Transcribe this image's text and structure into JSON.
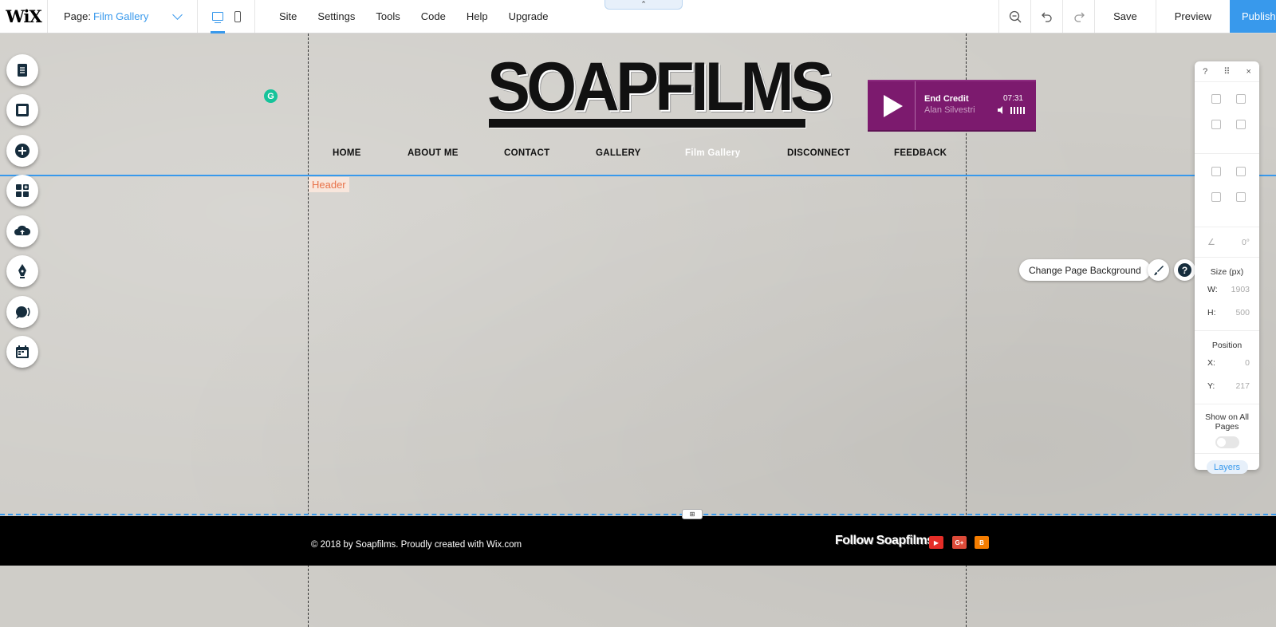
{
  "topbar": {
    "logo": "WiX",
    "page_label": "Page:",
    "page_name": "Film Gallery",
    "menu": [
      "Site",
      "Settings",
      "Tools",
      "Code",
      "Help",
      "Upgrade"
    ],
    "save": "Save",
    "preview": "Preview",
    "publish": "Publish",
    "collapse_glyph": "⌃"
  },
  "site": {
    "logo": "SOAPFILMS",
    "header_tag": "Header",
    "nav": [
      "HOME",
      "ABOUT ME",
      "CONTACT",
      "GALLERY",
      "Film Gallery",
      "DISCONNECT",
      "FEEDBACK"
    ],
    "active_nav_index": 4,
    "player": {
      "track": "End Credit",
      "artist": "Alan Silvestri",
      "time": "07:31",
      "accent": "#7c1a6e"
    },
    "change_background": "Change Page Background",
    "footer": {
      "copyright": "© 2018 by Soapfilms. Proudly created with Wix.com",
      "follow": "Follow Soapfilms:",
      "social": [
        {
          "name": "youtube-icon",
          "glyph": "▶",
          "color": "#e52d27"
        },
        {
          "name": "google-plus-icon",
          "glyph": "G+",
          "color": "#dd4b39"
        },
        {
          "name": "blogger-icon",
          "glyph": "B",
          "color": "#f57d00"
        }
      ]
    }
  },
  "panel": {
    "help": "?",
    "close": "×",
    "rotation": "0°",
    "size_label": "Size (px)",
    "w_label": "W:",
    "w_value": "1903",
    "h_label": "H:",
    "h_value": "500",
    "position_label": "Position",
    "x_label": "X:",
    "x_value": "0",
    "y_label": "Y:",
    "y_value": "217",
    "show_all_pages": "Show on All Pages",
    "layers": "Layers"
  },
  "colors": {
    "accent": "#3899ec",
    "header_tag": "#e8734a"
  }
}
